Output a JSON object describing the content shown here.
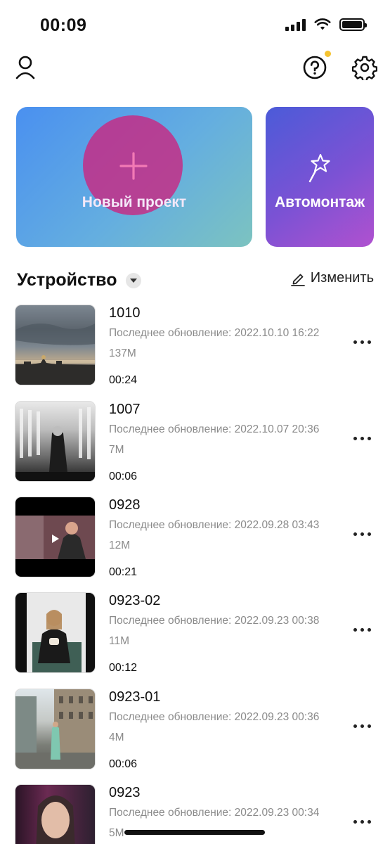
{
  "status_bar": {
    "time": "00:09"
  },
  "header": {
    "profile_icon": "user-icon",
    "help_icon": "help-circle-icon",
    "settings_icon": "gear-icon",
    "notification_color": "#f5c330"
  },
  "actions": {
    "new_project_label": "Новый проект",
    "auto_edit_label": "Автомонтаж"
  },
  "section": {
    "title": "Устройство",
    "edit_label": "Изменить"
  },
  "projects": [
    {
      "name": "1010",
      "updated": "Последнее обновление: 2022.10.10 16:22",
      "size": "137M",
      "duration": "00:24"
    },
    {
      "name": "1007",
      "updated": "Последнее обновление: 2022.10.07 20:36",
      "size": "7M",
      "duration": "00:06"
    },
    {
      "name": "0928",
      "updated": "Последнее обновление: 2022.09.28 03:43",
      "size": "12M",
      "duration": "00:21"
    },
    {
      "name": "0923-02",
      "updated": "Последнее обновление: 2022.09.23 00:38",
      "size": "11M",
      "duration": "00:12"
    },
    {
      "name": "0923-01",
      "updated": "Последнее обновление: 2022.09.23 00:36",
      "size": "4M",
      "duration": "00:06"
    },
    {
      "name": "0923",
      "updated": "Последнее обновление: 2022.09.23 00:34",
      "size": "5M",
      "duration": ""
    }
  ]
}
